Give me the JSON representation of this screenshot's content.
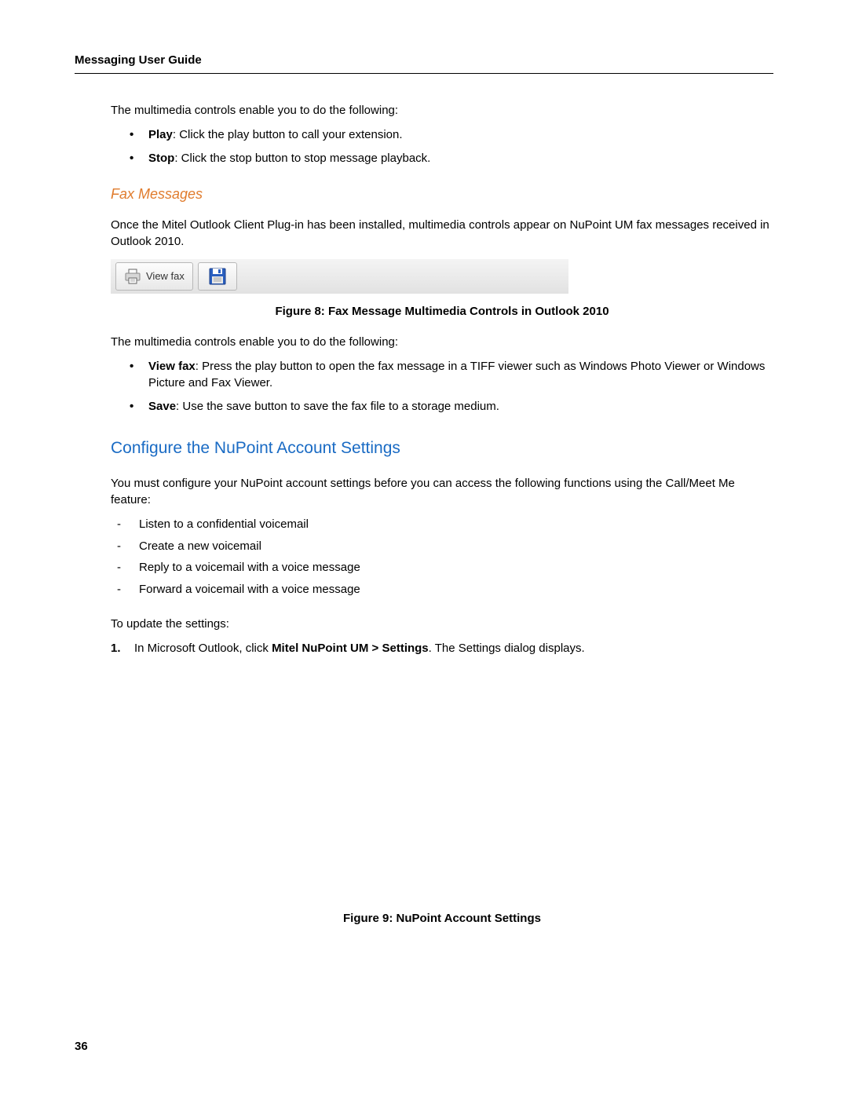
{
  "header": {
    "title": "Messaging User Guide"
  },
  "section1": {
    "intro": "The multimedia controls enable you to do the following:",
    "bullets": [
      {
        "label": "Play",
        "text": ": Click the play button to call your extension."
      },
      {
        "label": "Stop",
        "text": ": Click the stop button to stop message playback."
      }
    ]
  },
  "fax": {
    "heading": "Fax Messages",
    "para1": "Once the Mitel Outlook Client Plug-in has been installed, multimedia controls appear on NuPoint UM fax messages received in Outlook 2010.",
    "toolbar": {
      "viewFaxLabel": "View fax"
    },
    "caption": "Figure 8: Fax Message Multimedia Controls in Outlook 2010",
    "intro2": "The multimedia controls enable you to do the following:",
    "bullets": [
      {
        "label": "View fax",
        "text": ": Press the play button to open the fax message in a TIFF viewer such as Windows Photo Viewer or Windows Picture and Fax Viewer."
      },
      {
        "label": "Save",
        "text": ": Use the save button to save the fax file to a storage medium."
      }
    ]
  },
  "configure": {
    "heading": "Configure the NuPoint Account Settings",
    "para1": "You must configure your NuPoint account settings before you can access the following functions using the Call/Meet Me feature:",
    "dashes": [
      "Listen to a confidential voicemail",
      "Create a new voicemail",
      "Reply to a voicemail with a voice message",
      "Forward a voicemail with a voice message"
    ],
    "para2": "To update the settings:",
    "step1": {
      "num": "1.",
      "pre": "In Microsoft Outlook, click ",
      "bold": "Mitel NuPoint UM > Settings",
      "post": ". The Settings dialog displays."
    },
    "caption2": "Figure 9: NuPoint Account Settings"
  },
  "page": {
    "number": "36"
  }
}
